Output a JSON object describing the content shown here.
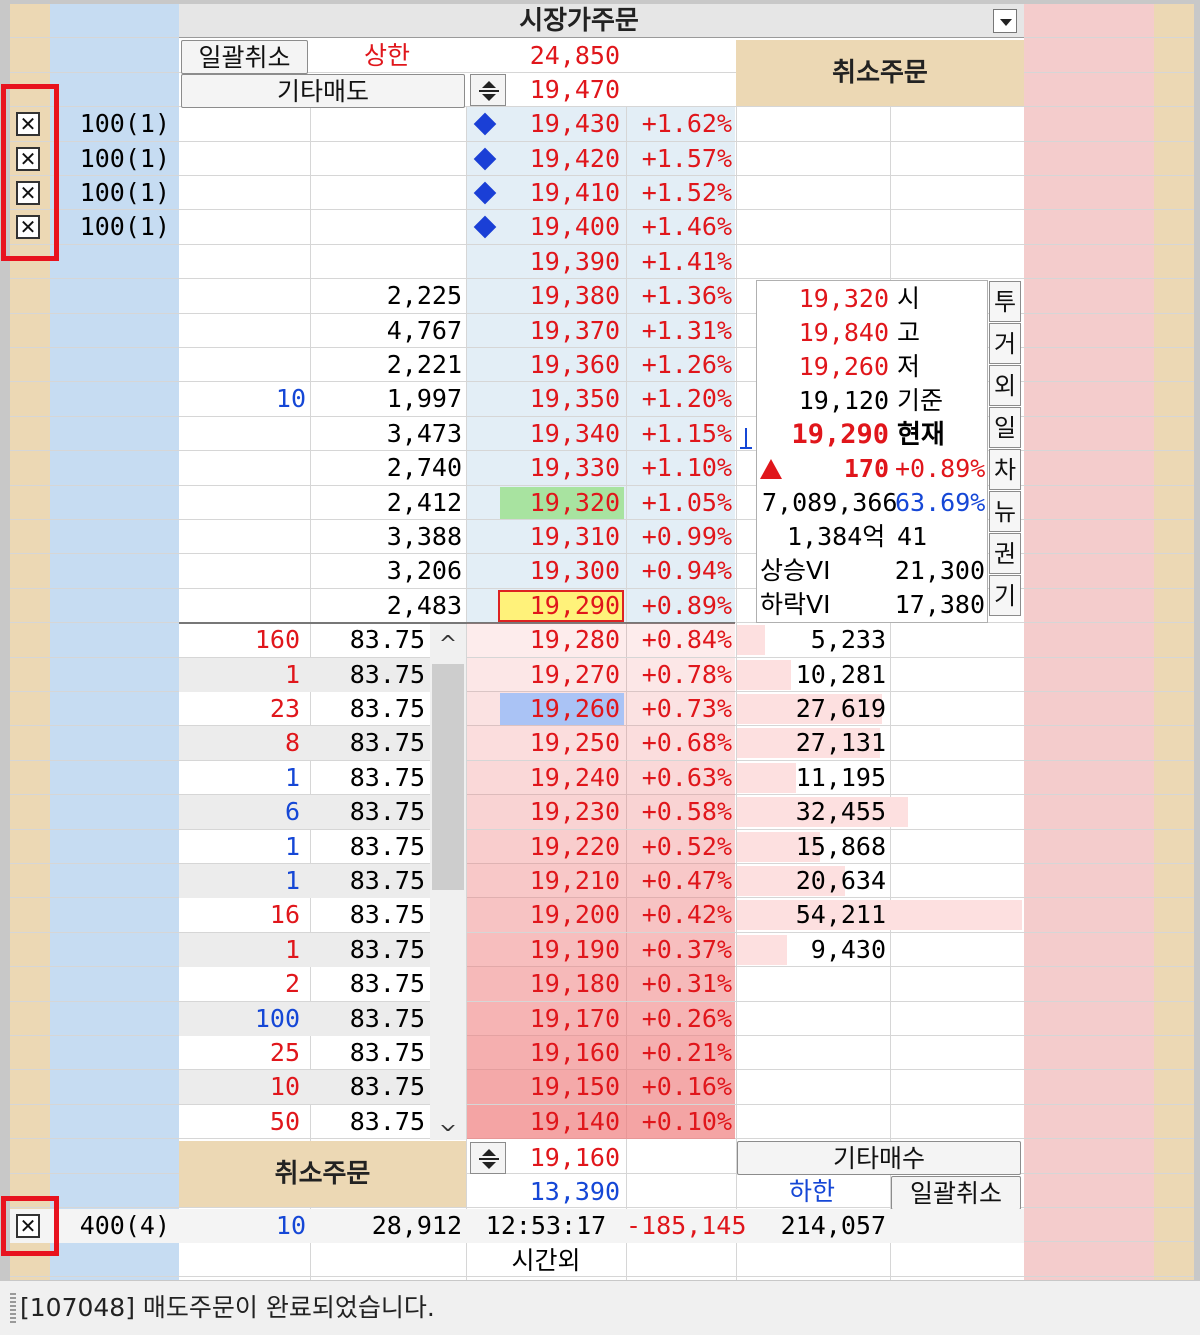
{
  "header": {
    "title": "시장가주문",
    "cancel_all_top": "일괄취소",
    "upper_limit_label": "상한",
    "upper_limit_price": "24,850",
    "other_sell": "기타매도",
    "sell_target_price": "19,470",
    "cancel_orders_top": "취소주문"
  },
  "sell_orders": [
    {
      "qty": "100(1)",
      "price": "19,430",
      "rate": "+1.62%"
    },
    {
      "qty": "100(1)",
      "price": "19,420",
      "rate": "+1.57%"
    },
    {
      "qty": "100(1)",
      "price": "19,410",
      "rate": "+1.52%"
    },
    {
      "qty": "100(1)",
      "price": "19,400",
      "rate": "+1.46%"
    }
  ],
  "ask_rows": [
    {
      "mine": "",
      "qty": "",
      "price": "19,390",
      "rate": "+1.41%"
    },
    {
      "mine": "",
      "qty": "2,225",
      "price": "19,380",
      "rate": "+1.36%"
    },
    {
      "mine": "",
      "qty": "4,767",
      "price": "19,370",
      "rate": "+1.31%"
    },
    {
      "mine": "",
      "qty": "2,221",
      "price": "19,360",
      "rate": "+1.26%"
    },
    {
      "mine": "10",
      "qty": "1,997",
      "price": "19,350",
      "rate": "+1.20%"
    },
    {
      "mine": "",
      "qty": "3,473",
      "price": "19,340",
      "rate": "+1.15%"
    },
    {
      "mine": "",
      "qty": "2,740",
      "price": "19,330",
      "rate": "+1.10%"
    },
    {
      "mine": "",
      "qty": "2,412",
      "price": "19,320",
      "rate": "+1.05%"
    },
    {
      "mine": "",
      "qty": "3,388",
      "price": "19,310",
      "rate": "+0.99%"
    },
    {
      "mine": "",
      "qty": "3,206",
      "price": "19,300",
      "rate": "+0.94%"
    },
    {
      "mine": "",
      "qty": "2,483",
      "price": "19,290",
      "rate": "+0.89%"
    }
  ],
  "info_panel": {
    "open_price": "19,320",
    "open_label": "시",
    "high_price": "19,840",
    "high_label": "고",
    "low_price": "19,260",
    "low_label": "저",
    "base_price": "19,120",
    "base_label": "기준",
    "current_price": "19,290",
    "current_label": "현재",
    "change": "170",
    "change_rate": "+0.89%",
    "volume": "7,089,366",
    "volume_ratio": "63.69%",
    "amount": "1,384억",
    "amount_extra": "41",
    "vi_up_label": "상승VI",
    "vi_up_price": "21,300",
    "vi_down_label": "하락VI",
    "vi_down_price": "17,380"
  },
  "side_tabs": [
    "투",
    "거",
    "외",
    "일",
    "차",
    "뉴",
    "권",
    "기"
  ],
  "bid_rows": [
    {
      "tick_qty": "160",
      "tick_price": "83.75",
      "price": "19,280",
      "rate": "+0.84%",
      "qty": "5,233"
    },
    {
      "tick_qty": "1",
      "tick_price": "83.75",
      "price": "19,270",
      "rate": "+0.78%",
      "qty": "10,281"
    },
    {
      "tick_qty": "23",
      "tick_price": "83.75",
      "price": "19,260",
      "rate": "+0.73%",
      "qty": "27,619"
    },
    {
      "tick_qty": "8",
      "tick_price": "83.75",
      "price": "19,250",
      "rate": "+0.68%",
      "qty": "27,131"
    },
    {
      "tick_qty": "1",
      "tick_price": "83.75",
      "price": "19,240",
      "rate": "+0.63%",
      "qty": "11,195"
    },
    {
      "tick_qty": "6",
      "tick_price": "83.75",
      "price": "19,230",
      "rate": "+0.58%",
      "qty": "32,455"
    },
    {
      "tick_qty": "1",
      "tick_price": "83.75",
      "price": "19,220",
      "rate": "+0.52%",
      "qty": "15,868"
    },
    {
      "tick_qty": "1",
      "tick_price": "83.75",
      "price": "19,210",
      "rate": "+0.47%",
      "qty": "20,634"
    },
    {
      "tick_qty": "16",
      "tick_price": "83.75",
      "price": "19,200",
      "rate": "+0.42%",
      "qty": "54,211"
    },
    {
      "tick_qty": "1",
      "tick_price": "83.75",
      "price": "19,190",
      "rate": "+0.37%",
      "qty": "9,430"
    },
    {
      "tick_qty": "2",
      "tick_price": "83.75",
      "price": "19,180",
      "rate": "+0.31%",
      "qty": ""
    },
    {
      "tick_qty": "100",
      "tick_price": "83.75",
      "price": "19,170",
      "rate": "+0.26%",
      "qty": ""
    },
    {
      "tick_qty": "25",
      "tick_price": "83.75",
      "price": "19,160",
      "rate": "+0.21%",
      "qty": ""
    },
    {
      "tick_qty": "10",
      "tick_price": "83.75",
      "price": "19,150",
      "rate": "+0.16%",
      "qty": ""
    },
    {
      "tick_qty": "50",
      "tick_price": "83.75",
      "price": "19,140",
      "rate": "+0.10%",
      "qty": ""
    }
  ],
  "footer": {
    "cancel_orders_bottom": "취소주문",
    "buy_target_price": "19,160",
    "other_buy": "기타매수",
    "lower_limit_price": "13,390",
    "lower_limit_label": "하한",
    "cancel_all_bottom": "일괄취소",
    "total_sell_orders": "400(4)",
    "total_mine": "10",
    "total_ask_qty": "28,912",
    "time": "12:53:17",
    "net_diff": "-185,145",
    "total_bid_qty": "214,057",
    "after_hours": "시간외"
  },
  "status_bar": {
    "message": "[107048] 매도주문이 완료되었습니다."
  },
  "colors": {
    "left_tan": "#ecd8b4",
    "left_blue": "#c6dcf2",
    "right_pink": "#f4cccc",
    "price_red": "#e0161b",
    "price_blue": "#1547d6",
    "highlight_green": "#a8e3a0",
    "highlight_yellow": "#fff27a",
    "highlight_blue": "#aac3f5"
  }
}
